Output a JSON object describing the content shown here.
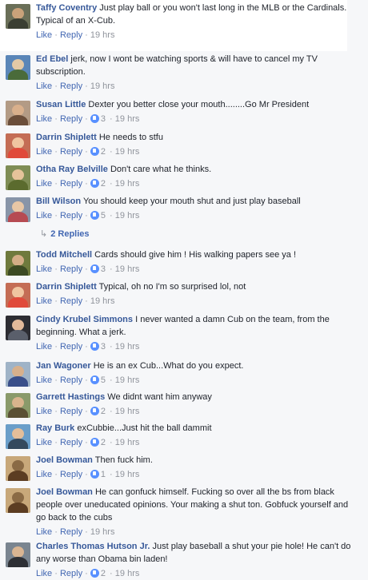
{
  "actions": {
    "like": "Like",
    "reply": "Reply",
    "sep": " · "
  },
  "comments": [
    {
      "author": "Taffy Coventry",
      "text": "Just play ball or you won't last long in the MLB or the Cardinals. Typical of an X-Cub.",
      "time": "19 hrs",
      "reactions": ""
    },
    {
      "author": "Ed Ebel",
      "text": "jerk, now I wont be watching sports & will have to cancel my TV subscription.",
      "time": "19 hrs",
      "reactions": ""
    },
    {
      "author": "Susan Little",
      "text": "Dexter you better close your mouth........Go Mr President",
      "time": "19 hrs",
      "reactions": "3"
    },
    {
      "author": "Darrin Shiplett",
      "text": "He needs to stfu",
      "time": "19 hrs",
      "reactions": "2"
    },
    {
      "author": "Otha Ray Belville",
      "text": "Don't care what he thinks.",
      "time": "19 hrs",
      "reactions": "2"
    },
    {
      "author": "Bill Wilson",
      "text": "You should keep your mouth shut and just play baseball",
      "time": "19 hrs",
      "reactions": "5"
    },
    {
      "author": "Todd Mitchell",
      "text": "Cards should give him ! His walking papers see ya !",
      "time": "19 hrs",
      "reactions": "3"
    },
    {
      "author": "Darrin Shiplett",
      "text": "Typical, oh no I'm so surprised lol, not",
      "time": "19 hrs",
      "reactions": ""
    },
    {
      "author": "Cindy Krubel Simmons",
      "text": "I never wanted a damn Cub on the team, from the beginning. What a jerk.",
      "time": "19 hrs",
      "reactions": "3"
    },
    {
      "author": "Jan Wagoner",
      "text": "He is an ex Cub...What do you expect.",
      "time": "19 hrs",
      "reactions": "5"
    },
    {
      "author": "Garrett Hastings",
      "text": "We didnt want him anyway",
      "time": "19 hrs",
      "reactions": "2"
    },
    {
      "author": "Ray Burk",
      "text": "exCubbie...Just hit the ball dammit",
      "time": "19 hrs",
      "reactions": "2"
    },
    {
      "author": "Joel Bowman",
      "text": "Then fuck him.",
      "time": "19 hrs",
      "reactions": "1"
    },
    {
      "author": "Joel Bowman",
      "text": "He can gonfuck himself. Fucking so over all the bs from black people over uneducated opinions. Your making a shut ton. Gobfuck yourself and go back to the cubs",
      "time": "19 hrs",
      "reactions": ""
    },
    {
      "author": "Charles Thomas Hutson Jr.",
      "text": "Just play baseball a shut your pie hole! He can't do any worse than Obama bin laden!",
      "time": "19 hrs",
      "reactions": "2"
    }
  ],
  "replies_link": "2 Replies",
  "replies_icon": "reply-arrow-icon",
  "reaction_icon": "like-reaction-icon",
  "colors": {
    "author": "#365899",
    "link": "#4267b2",
    "meta": "#90949c",
    "reaction": "#5890ff",
    "background": "#f6f7f9"
  }
}
